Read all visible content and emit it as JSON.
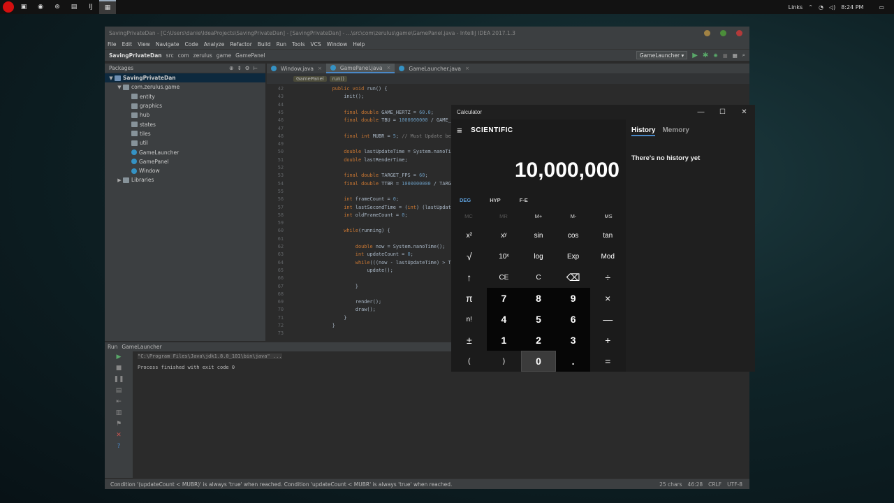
{
  "taskbar": {
    "links_label": "Links",
    "time": "8:24 PM",
    "icons": [
      "task-view-icon",
      "chrome-icon",
      "steam-icon",
      "file-explorer-icon",
      "intellij-icon",
      "calculator-icon"
    ]
  },
  "ide": {
    "window_title": "SavingPrivateDan - [C:\\Users\\danie\\IdeaProjects\\SavingPrivateDan] - [SavingPrivateDan] - ...\\src\\com\\zerulus\\game\\GamePanel.java - IntelliJ IDEA 2017.1.3",
    "menu": [
      "File",
      "Edit",
      "View",
      "Navigate",
      "Code",
      "Analyze",
      "Refactor",
      "Build",
      "Run",
      "Tools",
      "VCS",
      "Window",
      "Help"
    ],
    "breadcrumb": [
      "SavingPrivateDan",
      "src",
      "com",
      "zerulus",
      "game",
      "GamePanel"
    ],
    "run_config": "GameLauncher",
    "project_panel_title": "Packages",
    "tree": [
      {
        "label": "SavingPrivateDan",
        "depth": 0,
        "type": "module",
        "arrow": "▼",
        "selected": true
      },
      {
        "label": "com.zerulus.game",
        "depth": 1,
        "type": "package",
        "arrow": "▼"
      },
      {
        "label": "entity",
        "depth": 2,
        "type": "folder",
        "arrow": ""
      },
      {
        "label": "graphics",
        "depth": 2,
        "type": "folder",
        "arrow": ""
      },
      {
        "label": "hub",
        "depth": 2,
        "type": "folder",
        "arrow": ""
      },
      {
        "label": "states",
        "depth": 2,
        "type": "folder",
        "arrow": ""
      },
      {
        "label": "tiles",
        "depth": 2,
        "type": "folder",
        "arrow": ""
      },
      {
        "label": "util",
        "depth": 2,
        "type": "folder",
        "arrow": ""
      },
      {
        "label": "GameLauncher",
        "depth": 2,
        "type": "class",
        "arrow": ""
      },
      {
        "label": "GamePanel",
        "depth": 2,
        "type": "class",
        "arrow": ""
      },
      {
        "label": "Window",
        "depth": 2,
        "type": "class",
        "arrow": ""
      },
      {
        "label": "Libraries",
        "depth": 1,
        "type": "library",
        "arrow": "▶"
      }
    ],
    "tabs": [
      {
        "label": "Window.java",
        "active": false
      },
      {
        "label": "GamePanel.java",
        "active": true
      },
      {
        "label": "GameLauncher.java",
        "active": false
      }
    ],
    "code_crumbs": [
      "GamePanel",
      "run()"
    ],
    "code_lines": [
      {
        "n": "42",
        "t": "    public void run() {"
      },
      {
        "n": "43",
        "t": "        init();"
      },
      {
        "n": "44",
        "t": ""
      },
      {
        "n": "45",
        "t": "        final double GAME_HERTZ = 60.0;"
      },
      {
        "n": "46",
        "t": "        final double TBU = 1000000000 / GAME_HE"
      },
      {
        "n": "47",
        "t": ""
      },
      {
        "n": "48",
        "t": "        final int MUBR = 5; // Must Update befor"
      },
      {
        "n": "49",
        "t": ""
      },
      {
        "n": "50",
        "t": "        double lastUpdateTime = System.nanoTime("
      },
      {
        "n": "51",
        "t": "        double lastRenderTime;"
      },
      {
        "n": "52",
        "t": ""
      },
      {
        "n": "53",
        "t": "        final double TARGET_FPS = 60;"
      },
      {
        "n": "54",
        "t": "        final double TTBR = 1000000000 / TARGET_"
      },
      {
        "n": "55",
        "t": ""
      },
      {
        "n": "56",
        "t": "        int frameCount = 0;"
      },
      {
        "n": "57",
        "t": "        int lastSecondTime = (int) (lastUpdateTi"
      },
      {
        "n": "58",
        "t": "        int oldFrameCount = 0;"
      },
      {
        "n": "59",
        "t": ""
      },
      {
        "n": "60",
        "t": "        while(running) {"
      },
      {
        "n": "61",
        "t": ""
      },
      {
        "n": "62",
        "t": "            double now = System.nanoTime();"
      },
      {
        "n": "63",
        "t": "            int updateCount = 0;"
      },
      {
        "n": "64",
        "t": "            while(((now - lastUpdateTime) > TBU)"
      },
      {
        "n": "65",
        "t": "                update();"
      },
      {
        "n": "66",
        "t": ""
      },
      {
        "n": "67",
        "t": "            }"
      },
      {
        "n": "68",
        "t": ""
      },
      {
        "n": "69",
        "t": "            render();"
      },
      {
        "n": "70",
        "t": "            draw();"
      },
      {
        "n": "71",
        "t": "        }"
      },
      {
        "n": "72",
        "t": "    }"
      },
      {
        "n": "73",
        "t": ""
      }
    ],
    "run_panel": {
      "title": "Run",
      "config": "GameLauncher",
      "cmd": "\"C:\\Program Files\\Java\\jdk1.8.0_101\\bin\\java\" ...",
      "output": "Process finished with exit code 0"
    },
    "status": {
      "message": "Condition '(updateCount < MUBR)' is always 'true' when reached. Condition 'updateCount < MUBR' is always 'true' when reached.",
      "chars": "25 chars",
      "pos": "46:28",
      "line_sep": "CRLF",
      "encoding": "UTF-8"
    }
  },
  "calculator": {
    "title": "Calculator",
    "mode": "SCIENTIFIC",
    "display": "10,000,000",
    "units": [
      "DEG",
      "HYP",
      "F-E"
    ],
    "memory": [
      "MC",
      "MR",
      "M+",
      "M-",
      "MS"
    ],
    "keys": [
      {
        "label": "x²",
        "name": "square-button"
      },
      {
        "label": "xʸ",
        "name": "power-button"
      },
      {
        "label": "sin",
        "name": "sin-button"
      },
      {
        "label": "cos",
        "name": "cos-button"
      },
      {
        "label": "tan",
        "name": "tan-button"
      },
      {
        "label": "√",
        "name": "sqrt-button"
      },
      {
        "label": "10ˣ",
        "name": "ten-power-button"
      },
      {
        "label": "log",
        "name": "log-button"
      },
      {
        "label": "Exp",
        "name": "exp-button"
      },
      {
        "label": "Mod",
        "name": "mod-button"
      },
      {
        "label": "↑",
        "name": "shift-button"
      },
      {
        "label": "CE",
        "name": "clear-entry-button"
      },
      {
        "label": "C",
        "name": "clear-button"
      },
      {
        "label": "⌫",
        "name": "backspace-button"
      },
      {
        "label": "÷",
        "name": "divide-button"
      },
      {
        "label": "π",
        "name": "pi-button"
      },
      {
        "label": "7",
        "name": "digit-7-button",
        "num": true
      },
      {
        "label": "8",
        "name": "digit-8-button",
        "num": true
      },
      {
        "label": "9",
        "name": "digit-9-button",
        "num": true
      },
      {
        "label": "×",
        "name": "multiply-button"
      },
      {
        "label": "n!",
        "name": "factorial-button"
      },
      {
        "label": "4",
        "name": "digit-4-button",
        "num": true
      },
      {
        "label": "5",
        "name": "digit-5-button",
        "num": true
      },
      {
        "label": "6",
        "name": "digit-6-button",
        "num": true
      },
      {
        "label": "—",
        "name": "subtract-button"
      },
      {
        "label": "±",
        "name": "negate-button"
      },
      {
        "label": "1",
        "name": "digit-1-button",
        "num": true
      },
      {
        "label": "2",
        "name": "digit-2-button",
        "num": true
      },
      {
        "label": "3",
        "name": "digit-3-button",
        "num": true
      },
      {
        "label": "+",
        "name": "add-button"
      },
      {
        "label": "(",
        "name": "open-paren-button"
      },
      {
        "label": ")",
        "name": "close-paren-button"
      },
      {
        "label": "0",
        "name": "digit-0-button",
        "num": true,
        "hover": true
      },
      {
        "label": ".",
        "name": "decimal-button",
        "num": true
      },
      {
        "label": "=",
        "name": "equals-button"
      }
    ],
    "history_tab": "History",
    "memory_tab": "Memory",
    "history_empty": "There's no history yet"
  }
}
